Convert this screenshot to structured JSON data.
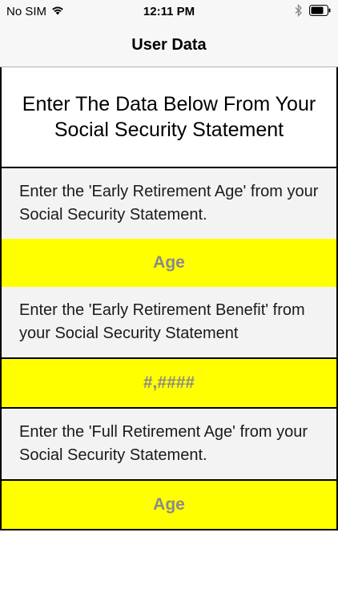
{
  "status_bar": {
    "carrier": "No SIM",
    "time": "12:11 PM",
    "wifi_icon": "wifi-icon",
    "bluetooth_icon": "bluetooth-icon",
    "battery_icon": "battery-icon"
  },
  "nav": {
    "title": "User Data"
  },
  "form": {
    "header": "Enter The Data Below From Your Social Security Statement",
    "fields": [
      {
        "instruction": "Enter the 'Early Retirement Age' from your Social Security Statement.",
        "placeholder": "Age",
        "value": ""
      },
      {
        "instruction": "Enter the 'Early Retirement Benefit' from your Social Security Statement",
        "placeholder": "#,####",
        "value": ""
      },
      {
        "instruction": "Enter the 'Full Retirement Age' from your Social Security Statement.",
        "placeholder": "Age",
        "value": ""
      }
    ]
  },
  "colors": {
    "input_background": "#ffff00",
    "instruction_background": "#f3f3f3",
    "border": "#000000",
    "placeholder_text": "#8a8a8a"
  }
}
